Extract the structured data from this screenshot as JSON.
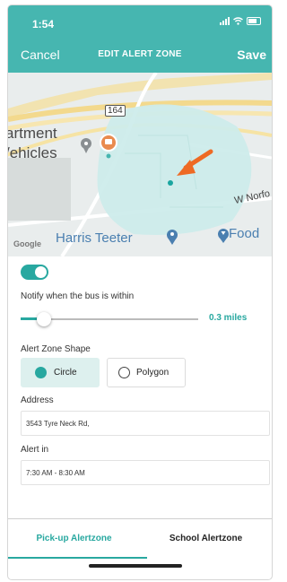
{
  "status_bar": {
    "time": "1:54"
  },
  "nav": {
    "cancel_label": "Cancel",
    "title": "EDIT ALERT ZONE",
    "save_label": "Save"
  },
  "map": {
    "labels": {
      "apartment": "artment",
      "vehicles": "/ehicles",
      "route": "164",
      "w_norfolk": "W Norfo",
      "google": "Google",
      "harris_teeter": "Harris Teeter",
      "food": "Food"
    },
    "zone_color": "#cdeceb",
    "arrow_color": "#ee6a24",
    "pin_color": "#e98b4e"
  },
  "form": {
    "toggle_on": true,
    "notify_label": "Notify when the bus is within",
    "distance": {
      "value_label": "0.3 miles",
      "fraction": 0.13
    },
    "shape_label": "Alert Zone Shape",
    "shape_options": [
      {
        "label": "Circle",
        "selected": true
      },
      {
        "label": "Polygon",
        "selected": false
      }
    ],
    "address_label": "Address",
    "address_value": "3543 Tyre Neck Rd,",
    "alert_in_label": "Alert in",
    "alert_in_value": "7:30 AM - 8:30 AM"
  },
  "tabs": [
    {
      "label": "Pick-up Alertzone",
      "active": true
    },
    {
      "label": "School Alertzone",
      "active": false
    }
  ],
  "colors": {
    "header": "#46b6b0",
    "accent": "#28a8a0"
  }
}
